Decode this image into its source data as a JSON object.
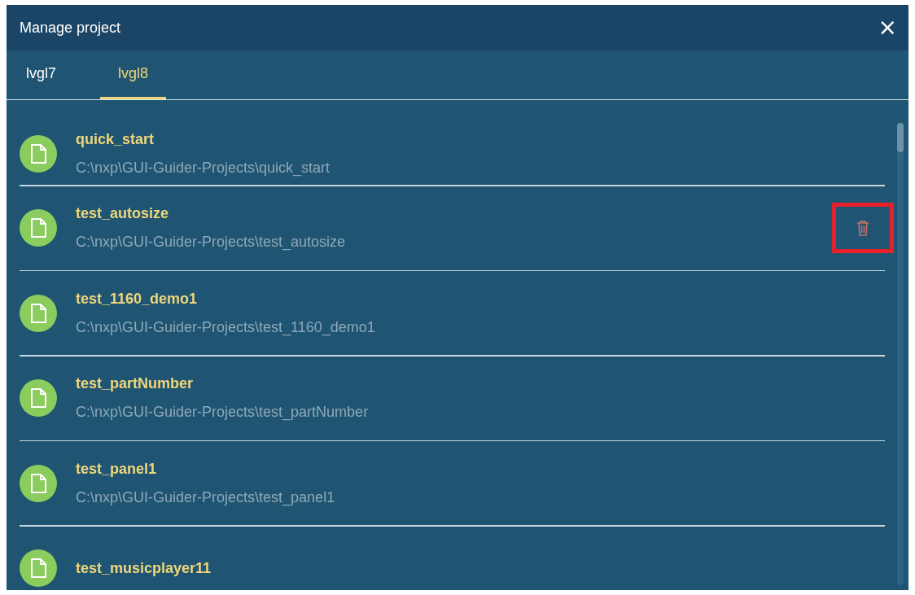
{
  "dialog": {
    "title": "Manage project",
    "close": "×"
  },
  "tabs": [
    {
      "label": "lvgl7",
      "selected": false
    },
    {
      "label": "lvgl8",
      "selected": true
    }
  ],
  "projects": [
    {
      "name": "quick_start",
      "path": "C:\\nxp\\GUI-Guider-Projects\\quick_start",
      "highlighted": false
    },
    {
      "name": "test_autosize",
      "path": "C:\\nxp\\GUI-Guider-Projects\\test_autosize",
      "highlighted": true
    },
    {
      "name": "test_1160_demo1",
      "path": "C:\\nxp\\GUI-Guider-Projects\\test_1160_demo1",
      "highlighted": false
    },
    {
      "name": "test_partNumber",
      "path": "C:\\nxp\\GUI-Guider-Projects\\test_partNumber",
      "highlighted": false
    },
    {
      "name": "test_panel1",
      "path": "C:\\nxp\\GUI-Guider-Projects\\test_panel1",
      "highlighted": false
    },
    {
      "name": "test_musicplayer11",
      "highlighted": false
    }
  ]
}
